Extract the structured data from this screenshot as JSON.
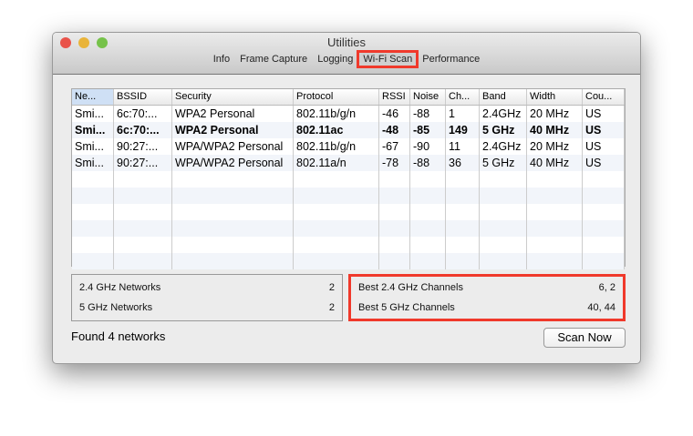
{
  "window": {
    "title": "Utilities"
  },
  "tabs": [
    {
      "label": "Info"
    },
    {
      "label": "Frame Capture"
    },
    {
      "label": "Logging"
    },
    {
      "label": "Wi-Fi Scan",
      "selected": true
    },
    {
      "label": "Performance"
    }
  ],
  "table": {
    "columns": [
      "Ne...",
      "BSSID",
      "Security",
      "Protocol",
      "RSSI",
      "Noise",
      "Ch...",
      "Band",
      "Width",
      "Cou..."
    ],
    "rows": [
      [
        "Smi...",
        "6c:70:...",
        "WPA2 Personal",
        "802.11b/g/n",
        "-46",
        "-88",
        "1",
        "2.4GHz",
        "20 MHz",
        "US"
      ],
      [
        "Smi...",
        "6c:70:...",
        "WPA2 Personal",
        "802.11ac",
        "-48",
        "-85",
        "149",
        "5 GHz",
        "40 MHz",
        "US"
      ],
      [
        "Smi...",
        "90:27:...",
        "WPA/WPA2 Personal",
        "802.11b/g/n",
        "-67",
        "-90",
        "11",
        "2.4GHz",
        "20 MHz",
        "US"
      ],
      [
        "Smi...",
        "90:27:...",
        "WPA/WPA2 Personal",
        "802.11a/n",
        "-78",
        "-88",
        "36",
        "5 GHz",
        "40 MHz",
        "US"
      ]
    ]
  },
  "summary": {
    "left": [
      {
        "label": "2.4 GHz Networks",
        "value": "2"
      },
      {
        "label": "5 GHz Networks",
        "value": "2"
      }
    ],
    "right": [
      {
        "label": "Best 2.4 GHz Channels",
        "value": "6, 2"
      },
      {
        "label": "Best 5 GHz Channels",
        "value": "40, 44"
      }
    ]
  },
  "status": "Found 4 networks",
  "scan_button": "Scan Now",
  "colors": {
    "highlight": "#f0392b"
  }
}
